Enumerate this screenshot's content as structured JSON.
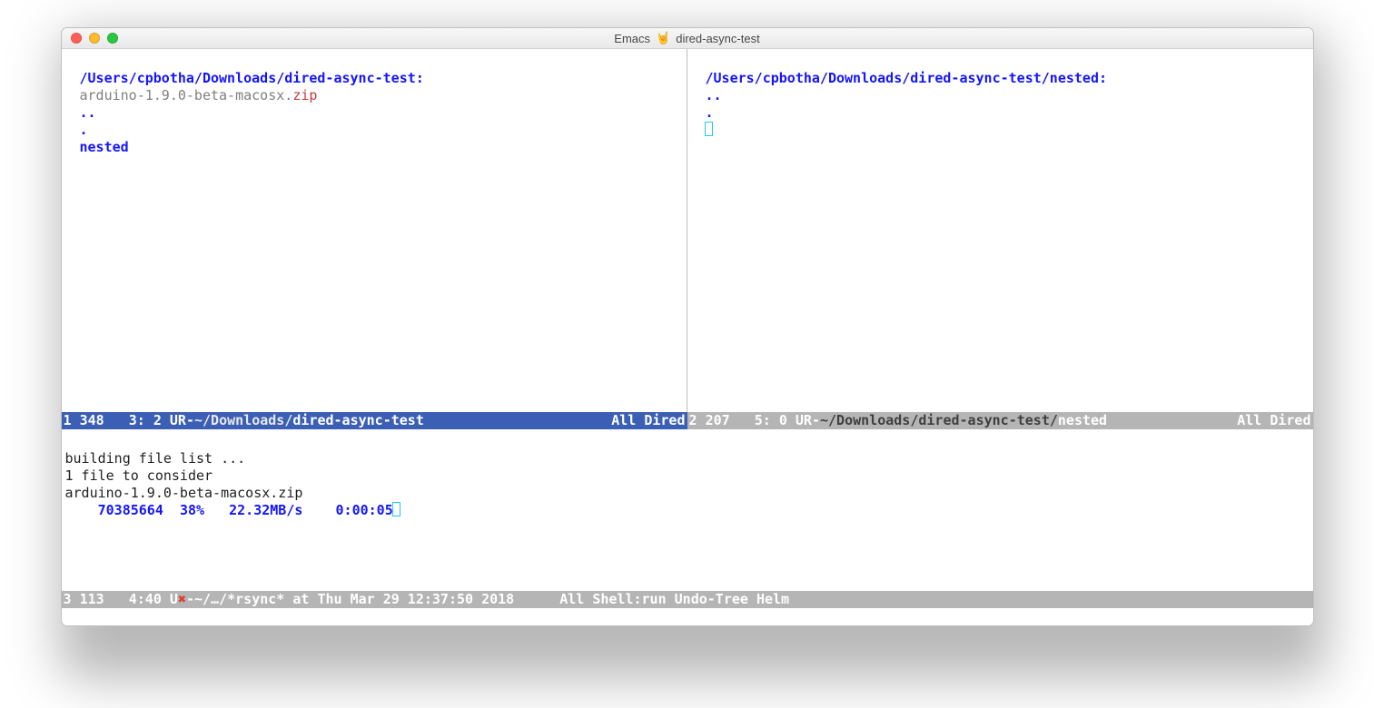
{
  "title": {
    "app": "Emacs",
    "buffer": "dired-async-test"
  },
  "left_pane": {
    "path": "/Users/cpbotha/Downloads/dired-async-test:",
    "file_base": "arduino-1.9.0-beta-macosx.",
    "file_ext": "zip",
    "dotdot": "..",
    "dot": ".",
    "dir": "nested"
  },
  "right_pane": {
    "path": "/Users/cpbotha/Downloads/dired-async-test/nested:",
    "dotdot": "..",
    "dot": "."
  },
  "modeline_left": {
    "win": "1",
    "size": "348",
    "pos": "3: 2",
    "flags": "UR-",
    "path": "~/Downloads/",
    "folder": "dired-async-test",
    "right": "All Dired"
  },
  "modeline_right": {
    "win": "2",
    "size": "207",
    "pos": "5: 0",
    "flags": "UR-",
    "path": "~/Downloads/dired-async-test/",
    "folder": "nested",
    "right": "All Dired"
  },
  "rsync": {
    "line1": "building file list ...",
    "line2": "1 file to consider",
    "line3": "arduino-1.9.0-beta-macosx.zip",
    "bytes": "70385664",
    "pct": "38%",
    "rate": "22.32MB/s",
    "eta": "0:00:05"
  },
  "modeline_bottom": {
    "win": "3",
    "size": "113",
    "pos": "4:40",
    "flags_pre": "U",
    "flags_post": "-~/…/",
    "buffer": "*rsync*",
    "timestamp": " at Thu Mar 29 12:37:50 2018",
    "right": "All Shell:run Undo-Tree Helm"
  }
}
